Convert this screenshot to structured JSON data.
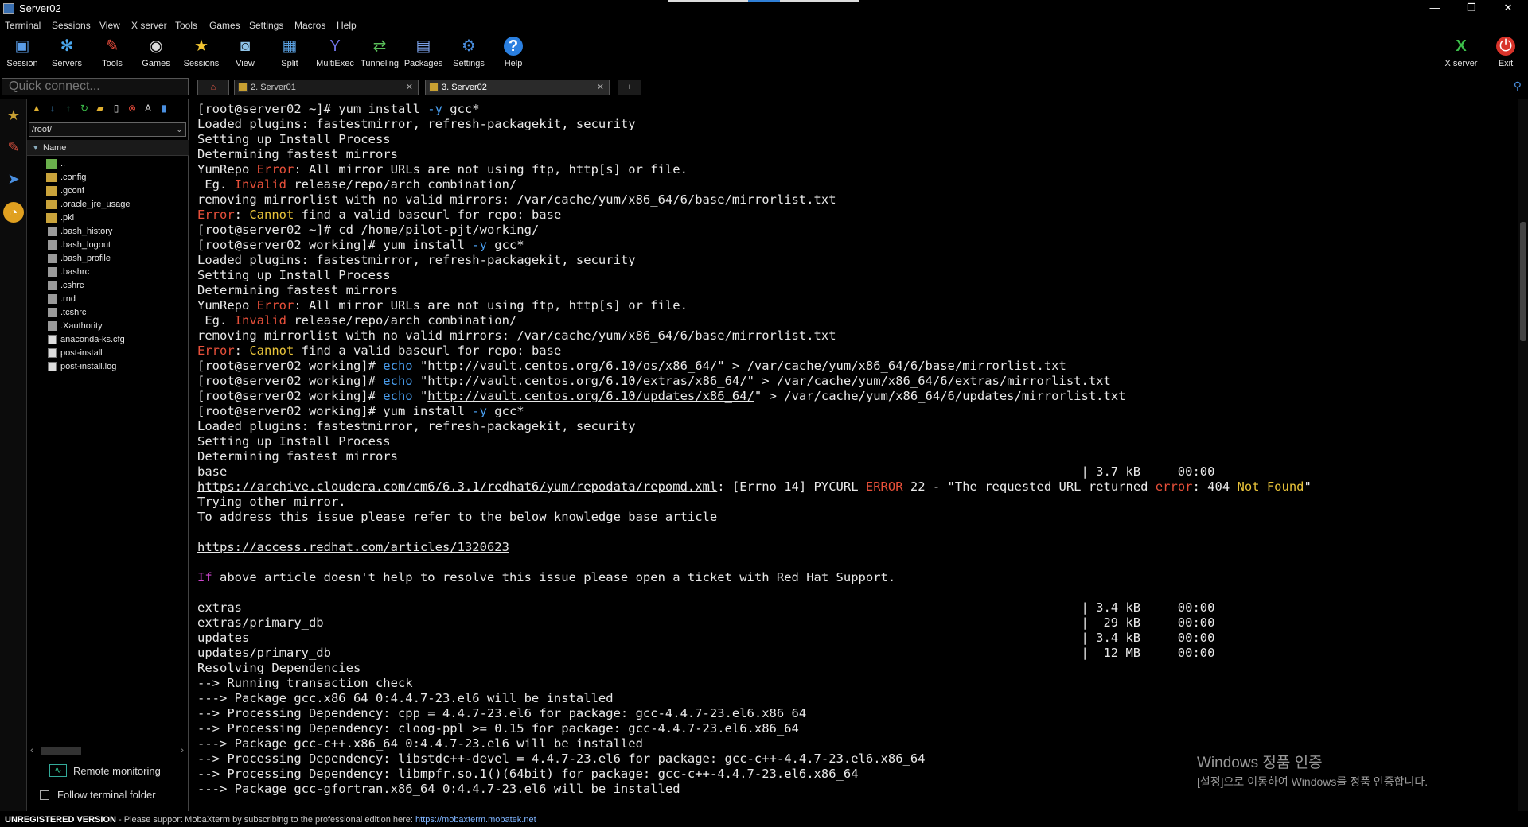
{
  "window": {
    "title": "Server02"
  },
  "menubar": [
    "Terminal",
    "Sessions",
    "View",
    "X server",
    "Tools",
    "Games",
    "Settings",
    "Macros",
    "Help"
  ],
  "toolbar": {
    "left": [
      {
        "label": "Session",
        "icon": "session-icon"
      },
      {
        "label": "Servers",
        "icon": "servers-icon"
      },
      {
        "label": "Tools",
        "icon": "tools-icon"
      },
      {
        "label": "Games",
        "icon": "games-icon"
      },
      {
        "label": "Sessions",
        "icon": "star-icon"
      },
      {
        "label": "View",
        "icon": "view-icon"
      },
      {
        "label": "Split",
        "icon": "split-icon"
      },
      {
        "label": "MultiExec",
        "icon": "multiexec-icon"
      },
      {
        "label": "Tunneling",
        "icon": "tunneling-icon"
      },
      {
        "label": "Packages",
        "icon": "packages-icon"
      },
      {
        "label": "Settings",
        "icon": "settings-icon"
      },
      {
        "label": "Help",
        "icon": "help-icon"
      }
    ],
    "right": [
      {
        "label": "X server",
        "icon": "xserver-icon"
      },
      {
        "label": "Exit",
        "icon": "power-icon"
      }
    ]
  },
  "quickconnect": {
    "placeholder": "Quick connect..."
  },
  "tabs": [
    {
      "label": "2. Server01",
      "active": false
    },
    {
      "label": "3. Server02",
      "active": true
    }
  ],
  "filepanel": {
    "path": "/root/",
    "column": "Name",
    "items": [
      {
        "name": "..",
        "type": "up"
      },
      {
        "name": ".config",
        "type": "folder"
      },
      {
        "name": ".gconf",
        "type": "folder"
      },
      {
        "name": ".oracle_jre_usage",
        "type": "folder"
      },
      {
        "name": ".pki",
        "type": "folder"
      },
      {
        "name": ".bash_history",
        "type": "file"
      },
      {
        "name": ".bash_logout",
        "type": "file"
      },
      {
        "name": ".bash_profile",
        "type": "file"
      },
      {
        "name": ".bashrc",
        "type": "file"
      },
      {
        "name": ".cshrc",
        "type": "file"
      },
      {
        "name": ".rnd",
        "type": "file"
      },
      {
        "name": ".tcshrc",
        "type": "file"
      },
      {
        "name": ".Xauthority",
        "type": "file"
      },
      {
        "name": "anaconda-ks.cfg",
        "type": "doc"
      },
      {
        "name": "post-install",
        "type": "doc"
      },
      {
        "name": "post-install.log",
        "type": "doc"
      }
    ],
    "remote_monitoring": "Remote monitoring",
    "follow_terminal": "Follow terminal folder"
  },
  "terminal": {
    "lines": [
      [
        {
          "t": "[root@server02 ~]# yum install "
        },
        {
          "t": "-y",
          "c": "blu"
        },
        {
          "t": " gcc*"
        }
      ],
      [
        {
          "t": "Loaded plugins: fastestmirror, refresh-packagekit, security"
        }
      ],
      [
        {
          "t": "Setting up Install Process"
        }
      ],
      [
        {
          "t": "Determining fastest mirrors"
        }
      ],
      [
        {
          "t": "YumRepo "
        },
        {
          "t": "Error",
          "c": "red"
        },
        {
          "t": ": All mirror URLs are not using ftp, http[s] or file."
        }
      ],
      [
        {
          "t": " Eg. "
        },
        {
          "t": "Invalid",
          "c": "red"
        },
        {
          "t": " release/repo/arch combination/"
        }
      ],
      [
        {
          "t": "removing mirrorlist with no valid mirrors: /var/cache/yum/x86_64/6/base/mirrorlist.txt"
        }
      ],
      [
        {
          "t": "Error",
          "c": "red"
        },
        {
          "t": ": "
        },
        {
          "t": "Cannot",
          "c": "yel"
        },
        {
          "t": " find a valid baseurl for repo: base"
        }
      ],
      [
        {
          "t": "[root@server02 ~]# cd /home/pilot-pjt/working/"
        }
      ],
      [
        {
          "t": "[root@server02 working]# yum install "
        },
        {
          "t": "-y",
          "c": "blu"
        },
        {
          "t": " gcc*"
        }
      ],
      [
        {
          "t": "Loaded plugins: fastestmirror, refresh-packagekit, security"
        }
      ],
      [
        {
          "t": "Setting up Install Process"
        }
      ],
      [
        {
          "t": "Determining fastest mirrors"
        }
      ],
      [
        {
          "t": "YumRepo "
        },
        {
          "t": "Error",
          "c": "red"
        },
        {
          "t": ": All mirror URLs are not using ftp, http[s] or file."
        }
      ],
      [
        {
          "t": " Eg. "
        },
        {
          "t": "Invalid",
          "c": "red"
        },
        {
          "t": " release/repo/arch combination/"
        }
      ],
      [
        {
          "t": "removing mirrorlist with no valid mirrors: /var/cache/yum/x86_64/6/base/mirrorlist.txt"
        }
      ],
      [
        {
          "t": "Error",
          "c": "red"
        },
        {
          "t": ": "
        },
        {
          "t": "Cannot",
          "c": "yel"
        },
        {
          "t": " find a valid baseurl for repo: base"
        }
      ],
      [
        {
          "t": "[root@server02 working]# "
        },
        {
          "t": "echo",
          "c": "blu"
        },
        {
          "t": " \""
        },
        {
          "t": "http://vault.centos.org/6.10/os/x86_64/",
          "c": "ul"
        },
        {
          "t": "\" > /var/cache/yum/x86_64/6/base/mirrorlist.txt"
        }
      ],
      [
        {
          "t": "[root@server02 working]# "
        },
        {
          "t": "echo",
          "c": "blu"
        },
        {
          "t": " \""
        },
        {
          "t": "http://vault.centos.org/6.10/extras/x86_64/",
          "c": "ul"
        },
        {
          "t": "\" > /var/cache/yum/x86_64/6/extras/mirrorlist.txt"
        }
      ],
      [
        {
          "t": "[root@server02 working]# "
        },
        {
          "t": "echo",
          "c": "blu"
        },
        {
          "t": " \""
        },
        {
          "t": "http://vault.centos.org/6.10/updates/x86_64/",
          "c": "ul"
        },
        {
          "t": "\" > /var/cache/yum/x86_64/6/updates/mirrorlist.txt"
        }
      ],
      [
        {
          "t": "[root@server02 working]# yum install "
        },
        {
          "t": "-y",
          "c": "blu"
        },
        {
          "t": " gcc*"
        }
      ],
      [
        {
          "t": "Loaded plugins: fastestmirror, refresh-packagekit, security"
        }
      ],
      [
        {
          "t": "Setting up Install Process"
        }
      ],
      [
        {
          "t": "Determining fastest mirrors"
        }
      ],
      [
        {
          "t": "base                                                                                                                   | 3.7 kB     00:00"
        }
      ],
      [
        {
          "t": "https://archive.cloudera.com/cm6/6.3.1/redhat6/yum/repodata/repomd.xml",
          "c": "ul"
        },
        {
          "t": ": [Errno 14] PYCURL "
        },
        {
          "t": "ERROR",
          "c": "red"
        },
        {
          "t": " 22 - \"The requested URL returned "
        },
        {
          "t": "error",
          "c": "red"
        },
        {
          "t": ": 404 "
        },
        {
          "t": "Not Found",
          "c": "yel"
        },
        {
          "t": "\""
        }
      ],
      [
        {
          "t": "Trying other mirror."
        }
      ],
      [
        {
          "t": "To address this issue please refer to the below knowledge base article"
        }
      ],
      [
        {
          "t": ""
        }
      ],
      [
        {
          "t": "https://access.redhat.com/articles/1320623",
          "c": "ul"
        }
      ],
      [
        {
          "t": ""
        }
      ],
      [
        {
          "t": "If",
          "c": "mag"
        },
        {
          "t": " above article doesn't help to resolve this issue please open a ticket with Red Hat Support."
        }
      ],
      [
        {
          "t": ""
        }
      ],
      [
        {
          "t": "extras                                                                                                                 | 3.4 kB     00:00"
        }
      ],
      [
        {
          "t": "extras/primary_db                                                                                                      |  29 kB     00:00"
        }
      ],
      [
        {
          "t": "updates                                                                                                                | 3.4 kB     00:00"
        }
      ],
      [
        {
          "t": "updates/primary_db                                                                                                     |  12 MB     00:00"
        }
      ],
      [
        {
          "t": "Resolving Dependencies"
        }
      ],
      [
        {
          "t": "--> Running transaction check"
        }
      ],
      [
        {
          "t": "---> Package gcc.x86_64 0:4.4.7-23.el6 will be installed"
        }
      ],
      [
        {
          "t": "--> Processing Dependency: cpp = 4.4.7-23.el6 for package: gcc-4.4.7-23.el6.x86_64"
        }
      ],
      [
        {
          "t": "--> Processing Dependency: cloog-ppl >= 0.15 for package: gcc-4.4.7-23.el6.x86_64"
        }
      ],
      [
        {
          "t": "---> Package gcc-c++.x86_64 0:4.4.7-23.el6 will be installed"
        }
      ],
      [
        {
          "t": "--> Processing Dependency: libstdc++-devel = 4.4.7-23.el6 for package: gcc-c++-4.4.7-23.el6.x86_64"
        }
      ],
      [
        {
          "t": "--> Processing Dependency: libmpfr.so.1()(64bit) for package: gcc-c++-4.4.7-23.el6.x86_64"
        }
      ],
      [
        {
          "t": "---> Package gcc-gfortran.x86_64 0:4.4.7-23.el6 will be installed"
        }
      ]
    ]
  },
  "watermark": {
    "line1": "Windows 정품 인증",
    "line2": "[설정]으로 이동하여 Windows를 정품 인증합니다."
  },
  "statusbar": {
    "bold": "UNREGISTERED VERSION",
    "text": "  -  Please support MobaXterm by subscribing to the professional edition here:  ",
    "link": "https://mobaxterm.mobatek.net"
  },
  "colors": {
    "error": "#e8503a",
    "warning": "#e8c33a",
    "option": "#4a9ff0",
    "keyword": "#d047d0",
    "folder": "#c9a33b"
  }
}
